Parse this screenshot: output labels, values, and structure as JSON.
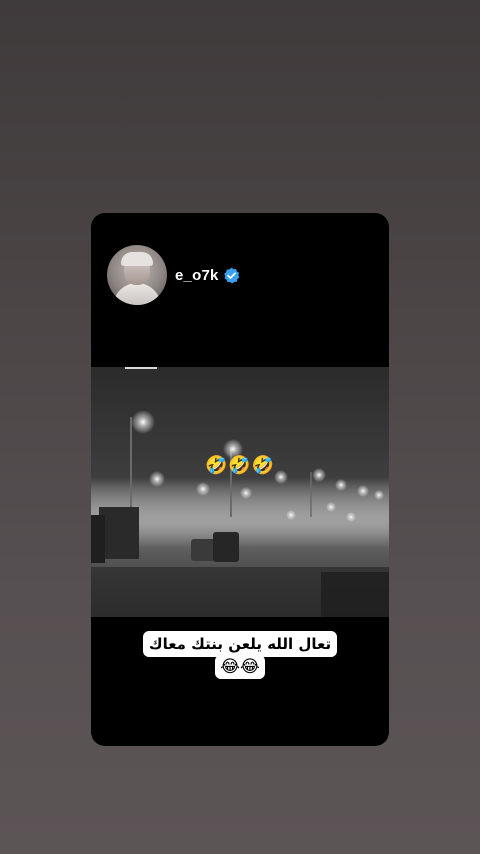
{
  "post": {
    "username": "e_o7k",
    "verified": true,
    "video_emojis": "🤣🤣🤣",
    "caption_line1": "تعال الله  يلعن بنتك معاك",
    "caption_line2": "😂😂"
  },
  "colors": {
    "verified_badge": "#3aa0f0",
    "card_background": "#000000",
    "caption_background": "#ffffff"
  }
}
